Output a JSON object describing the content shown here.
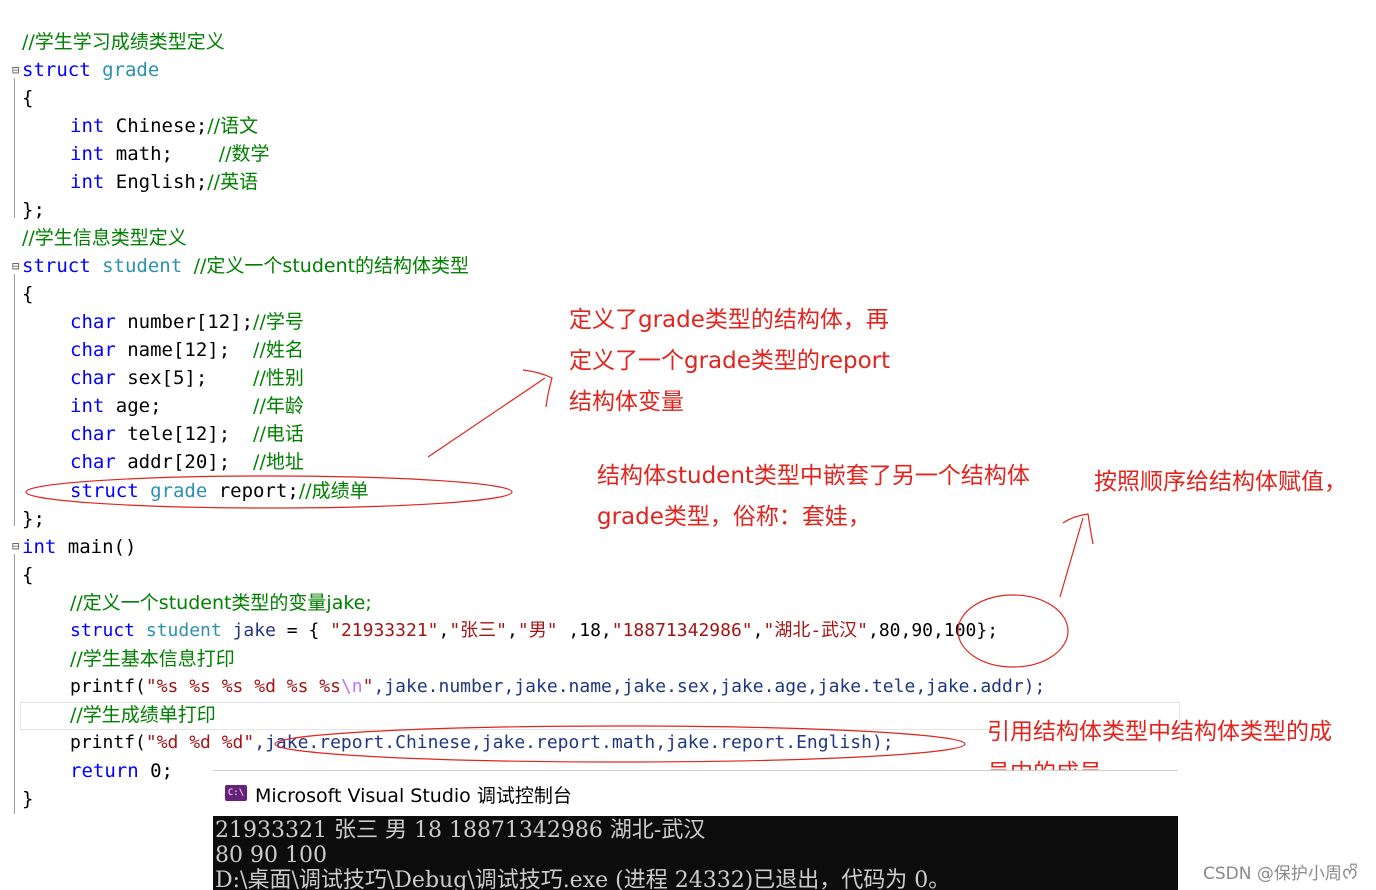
{
  "code": {
    "l01": "//学生学习成绩类型定义",
    "l02_kw": "struct",
    "l02_name": "grade",
    "l03": "{",
    "l04_kw": "int",
    "l04_rest": " Chinese;",
    "l04_cm": "//语文",
    "l05_kw": "int",
    "l05_rest": " math;    ",
    "l05_cm": "//数学",
    "l06_kw": "int",
    "l06_rest": " English;",
    "l06_cm": "//英语",
    "l07": "};",
    "l08": "//学生信息类型定义",
    "l09_kw": "struct",
    "l09_name": "student",
    "l09_cm": "//定义一个student的结构体类型",
    "l10": "{",
    "l11_kw": "char",
    "l11_rest": " number[12];",
    "l11_cm": "//学号",
    "l12_kw": "char",
    "l12_rest": " name[12];  ",
    "l12_cm": "//姓名",
    "l13_kw": "char",
    "l13_rest": " sex[5];    ",
    "l13_cm": "//性别",
    "l14_kw": "int",
    "l14_rest": " age;        ",
    "l14_cm": "//年龄",
    "l15_kw": "char",
    "l15_rest": " tele[12];  ",
    "l15_cm": "//电话",
    "l16_kw": "char",
    "l16_rest": " addr[20];  ",
    "l16_cm": "//地址",
    "l17_kw": "struct",
    "l17_type": "grade",
    "l17_rest": " report;",
    "l17_cm": "//成绩单",
    "l18": "};",
    "l19_kw": "int",
    "l19_rest": " main()",
    "l20": "{",
    "l21_cm": "//定义一个student类型的变量jake;",
    "l22_kw": "struct",
    "l22_type": "student",
    "l22_var": "jake",
    "l22_eq": " = { ",
    "l22_s1": "\"21933321\"",
    "l22_c1": ",",
    "l22_s2": "\"张三\"",
    "l22_c2": ",",
    "l22_s3": "\"男\"",
    "l22_c3": " ,18,",
    "l22_s4": "\"18871342986\"",
    "l22_c4": ",",
    "l22_s5": "\"湖北-武汉\"",
    "l22_tail": ",80,90,100};",
    "l23_cm": "//学生基本信息打印",
    "l24_fn": "printf(",
    "l24_fmt": "\"%s %s %s %d %s %s",
    "l24_esc": "\\n",
    "l24_q": "\"",
    "l24_args": ",jake.number,jake.name,jake.sex,jake.age,jake.tele,jake.addr);",
    "l25_cm": "//学生成绩单打印",
    "l26_fn": "printf(",
    "l26_fmt": "\"%d %d %d\"",
    "l26_args": ",jake.report.Chinese,jake.report.math,jake.report.English);",
    "l27_kw": "return",
    "l27_rest": " 0;",
    "l28": "}"
  },
  "annotations": {
    "a1_l1": "定义了grade类型的结构体，再",
    "a1_l2": "定义了一个grade类型的report",
    "a1_l3": "结构体变量",
    "a2_l1": "结构体student类型中嵌套了另一个结构体",
    "a2_l2": "grade类型，俗称：套娃，",
    "a3_l1": "按照顺序给结构体赋值，",
    "a4_l1": "引用结构体类型中结构体类型的成",
    "a4_l2": "员中的成员"
  },
  "console": {
    "title": "Microsoft Visual Studio 调试控制台",
    "icon_label": "C:\\",
    "line1": "21933321 张三 男 18 18871342986 湖北-武汉",
    "line2": "80 90 100",
    "line3": "D:\\桌面\\调试技巧\\Debug\\调试技巧.exe (进程 24332)已退出，代码为 0。"
  },
  "watermark": "CSDN @保护小周ᰔᩚ",
  "colors": {
    "keyword": "#0000ff",
    "type": "#2b91af",
    "comment": "#008000",
    "string": "#a31515",
    "variable": "#1f377f",
    "annotation": "#e0241e",
    "console_bg": "#0c0c0c"
  }
}
